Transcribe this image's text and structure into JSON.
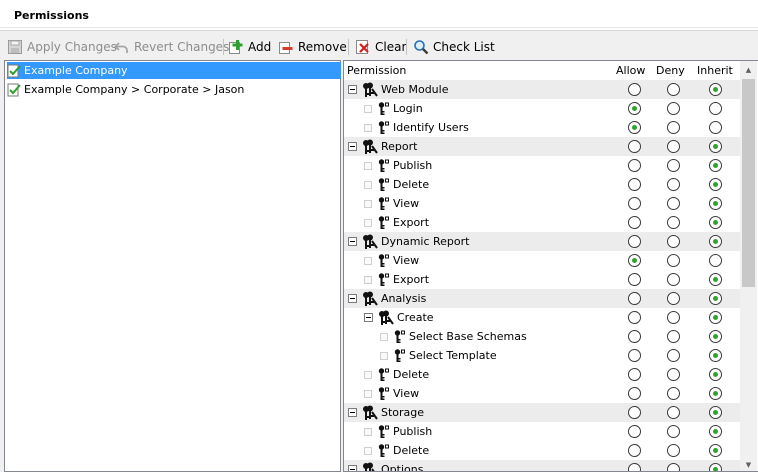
{
  "title": "Permissions",
  "toolbar": {
    "apply": "Apply Changes",
    "revert": "Revert Changes",
    "add": "Add",
    "remove": "Remove",
    "clear": "Clear",
    "checklist": "Check List"
  },
  "tree": {
    "items": [
      {
        "label": "Example Company",
        "selected": true
      },
      {
        "label": "Example Company > Corporate > Jason",
        "selected": false
      }
    ]
  },
  "grid": {
    "headers": {
      "permission": "Permission",
      "allow": "Allow",
      "deny": "Deny",
      "inherit": "Inherit"
    },
    "rows": [
      {
        "label": "Web Module",
        "level": 0,
        "type": "group",
        "state": "inherit"
      },
      {
        "label": "Login",
        "level": 1,
        "type": "leaf",
        "state": "allow"
      },
      {
        "label": "Identify Users",
        "level": 1,
        "type": "leaf",
        "state": "allow"
      },
      {
        "label": "Report",
        "level": 0,
        "type": "group",
        "state": "inherit"
      },
      {
        "label": "Publish",
        "level": 1,
        "type": "leaf",
        "state": "inherit"
      },
      {
        "label": "Delete",
        "level": 1,
        "type": "leaf",
        "state": "inherit"
      },
      {
        "label": "View",
        "level": 1,
        "type": "leaf",
        "state": "inherit"
      },
      {
        "label": "Export",
        "level": 1,
        "type": "leaf",
        "state": "inherit"
      },
      {
        "label": "Dynamic Report",
        "level": 0,
        "type": "group",
        "state": "inherit"
      },
      {
        "label": "View",
        "level": 1,
        "type": "leaf",
        "state": "allow"
      },
      {
        "label": "Export",
        "level": 1,
        "type": "leaf",
        "state": "inherit"
      },
      {
        "label": "Analysis",
        "level": 0,
        "type": "group",
        "state": "inherit"
      },
      {
        "label": "Create",
        "level": 1,
        "type": "group",
        "state": "inherit"
      },
      {
        "label": "Select Base Schemas",
        "level": 2,
        "type": "leaf",
        "state": "inherit"
      },
      {
        "label": "Select Template",
        "level": 2,
        "type": "leaf",
        "state": "inherit"
      },
      {
        "label": "Delete",
        "level": 1,
        "type": "leaf",
        "state": "inherit"
      },
      {
        "label": "View",
        "level": 1,
        "type": "leaf",
        "state": "inherit"
      },
      {
        "label": "Storage",
        "level": 0,
        "type": "group",
        "state": "inherit"
      },
      {
        "label": "Publish",
        "level": 1,
        "type": "leaf",
        "state": "inherit"
      },
      {
        "label": "Delete",
        "level": 1,
        "type": "leaf",
        "state": "inherit"
      },
      {
        "label": "Options",
        "level": 0,
        "type": "group",
        "state": "inherit"
      }
    ]
  },
  "icons": {
    "apply": "save-disk-icon",
    "revert": "undo-arrow-icon",
    "add": "add-plus-icon",
    "remove": "remove-minus-icon",
    "clear": "clear-x-icon",
    "checklist": "magnifier-icon",
    "group": "keys-group-icon",
    "leaf": "key-icon"
  },
  "colors": {
    "selection": "#3399ff",
    "radio_dot": "#2fa32f",
    "group_row": "#ececec"
  }
}
